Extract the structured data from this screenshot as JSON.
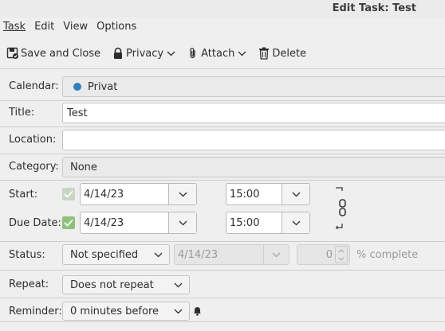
{
  "window": {
    "title": "Edit Task: Test"
  },
  "menu": [
    "Task",
    "Edit",
    "View",
    "Options"
  ],
  "toolbar": {
    "save": "Save and Close",
    "privacy": "Privacy",
    "attach": "Attach",
    "delete": "Delete"
  },
  "form": {
    "calendar": {
      "label": "Calendar:",
      "value": "Privat",
      "color": "#2f7fc1"
    },
    "title": {
      "label": "Title:",
      "value": "Test"
    },
    "location": {
      "label": "Location:",
      "value": ""
    },
    "category": {
      "label": "Category:",
      "value": "None"
    },
    "start": {
      "label": "Start:",
      "date": "4/14/23",
      "time": "15:00",
      "checked": true,
      "enabled": false
    },
    "due": {
      "label": "Due Date:",
      "date": "4/14/23",
      "time": "15:00",
      "checked": true,
      "enabled": true
    },
    "status": {
      "label": "Status:",
      "value": "Not specified",
      "date": "4/14/23",
      "percent": "0",
      "percent_label": "% complete"
    },
    "repeat": {
      "label": "Repeat:",
      "value": "Does not repeat"
    },
    "reminder": {
      "label": "Reminder:",
      "value": "0 minutes before"
    }
  },
  "icons": [
    "save-icon",
    "lock-icon",
    "paperclip-icon",
    "trash-icon",
    "chevron-down-icon",
    "link-icon",
    "bell-icon"
  ]
}
